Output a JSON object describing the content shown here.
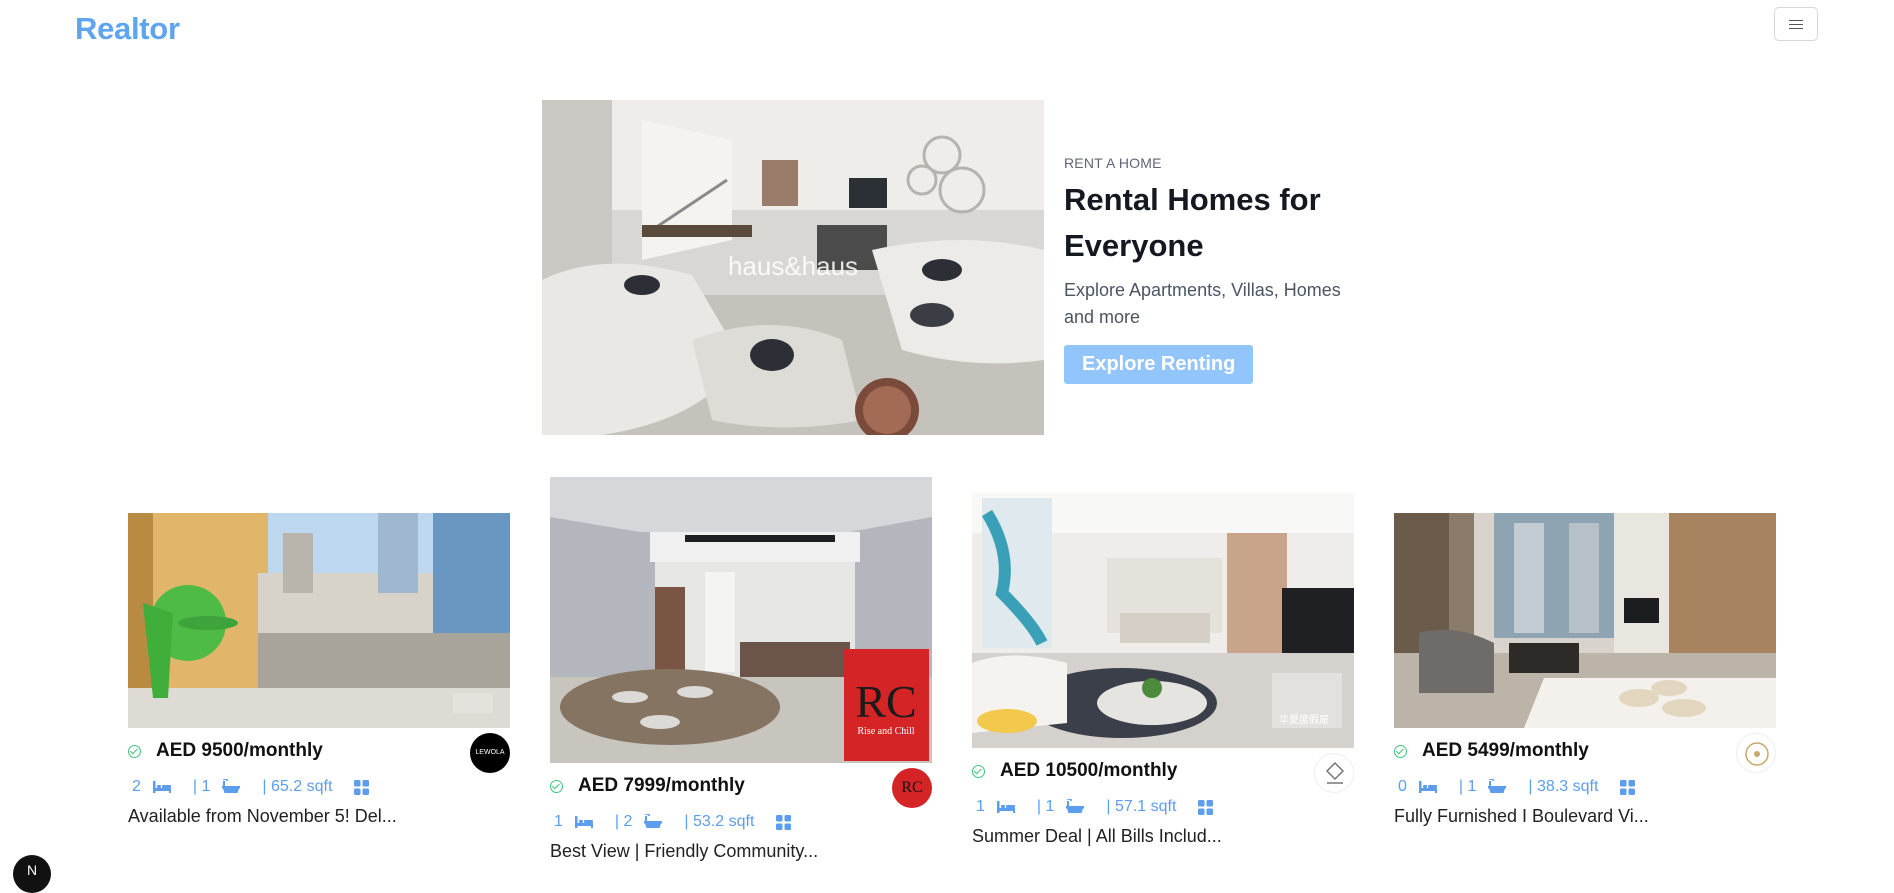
{
  "header": {
    "logo": "Realtor",
    "menu_icon": "hamburger-icon"
  },
  "hero": {
    "image_watermark": "haus&haus",
    "kicker": "RENT A HOME",
    "title": "Rental Homes for Everyone",
    "description": "Explore Apartments, Villas, Homes and more",
    "button": "Explore Renting"
  },
  "listings": [
    {
      "price": "AED 9500/monthly",
      "rooms": "2",
      "baths": "1",
      "area": "65.2 sqft",
      "title": "Available from November 5! Del...",
      "agency": "LEWOLA"
    },
    {
      "price": "AED 7999/monthly",
      "rooms": "1",
      "baths": "2",
      "area": "53.2 sqft",
      "title": "Best View | Friendly Community...",
      "agency": "RC",
      "watermark": "Rise and Chill"
    },
    {
      "price": "AED 10500/monthly",
      "rooms": "1",
      "baths": "1",
      "area": "57.1 sqft",
      "title": "Summer Deal | All Bills Includ...",
      "agency": "",
      "watermark": "华夏度假屋"
    },
    {
      "price": "AED 5499/monthly",
      "rooms": "0",
      "baths": "1",
      "area": "38.3 sqft",
      "title": "Fully Furnished I Boulevard Vi...",
      "agency": ""
    }
  ],
  "colors": {
    "brand": "#5fa4f0",
    "button": "#93c5fd",
    "verified": "#3ec57a",
    "stats": "#5c9ded"
  },
  "corner_avatar": "N"
}
